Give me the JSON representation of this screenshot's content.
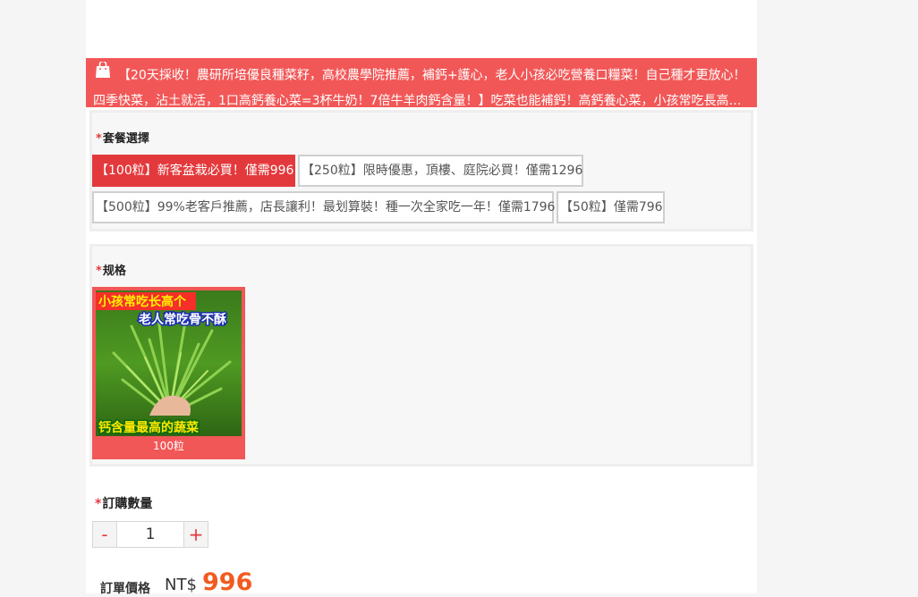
{
  "banner": {
    "line1": "【20天採收！農研所培優良種菜籽，高校農學院推薦，補鈣+護心，老人小孩必吃營養口糧菜！自己種才更放心！",
    "line2": "四季快菜，沾土就活，1口高鈣養心菜=3杯牛奶！7倍牛羊肉鈣含量！】吃菜也能補鈣！高鈣養心菜，小孩常吃長高個..."
  },
  "package": {
    "required_mark": "*",
    "label": "套餐選擇",
    "options": [
      "【100粒】新客盆栽必買！僅需996",
      "【250粒】限時優惠，頂樓、庭院必買！僅需1296",
      "【500粒】99%老客戶推薦，店長讓利！最划算裝！種一次全家吃一年！僅需1796",
      "【50粒】僅需796"
    ],
    "selected_index": 0
  },
  "spec": {
    "required_mark": "*",
    "label": "规格",
    "image_texts": [
      "小孩常吃长高个",
      "老人常吃骨不酥",
      "钙含量最高的蔬菜"
    ],
    "caption": "100粒"
  },
  "quantity": {
    "required_mark": "*",
    "label": "訂購數量",
    "minus": "-",
    "value": "1",
    "plus": "+"
  },
  "price": {
    "label": "訂單價格",
    "currency": "NT$",
    "value": "996"
  },
  "colors": {
    "accent": "#e4393c",
    "banner": "#f25757",
    "price": "#f25a1f"
  }
}
